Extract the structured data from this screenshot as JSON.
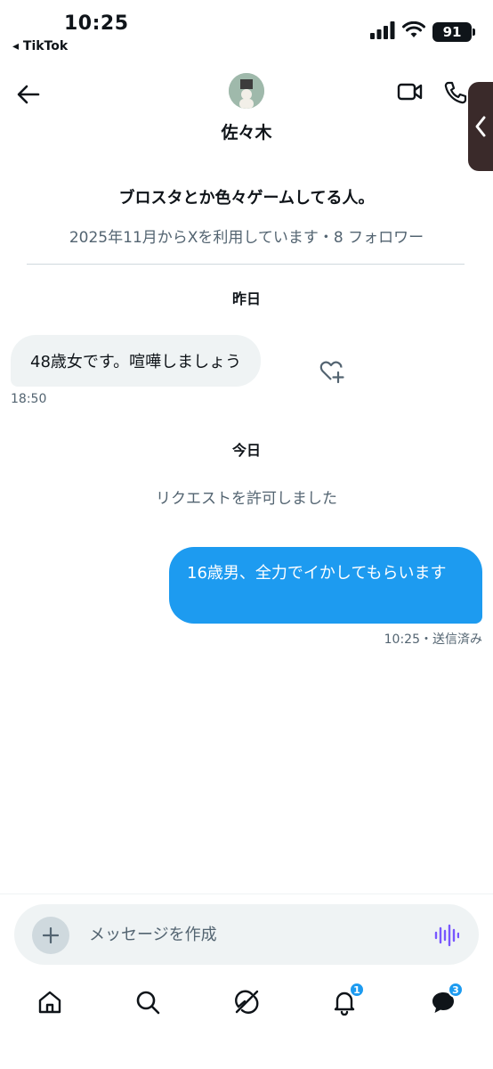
{
  "status_bar": {
    "time": "10:25",
    "back_app": "◂ TikTok",
    "battery": "91"
  },
  "header": {
    "contact_name": "佐々木"
  },
  "profile": {
    "bio": "ブロスタとか色々ゲームしてる人。",
    "meta": "2025年11月からXを利用しています・8 フォロワー"
  },
  "messages": {
    "day_yesterday": "昨日",
    "incoming_text": "48歳女です。喧嘩しましょう",
    "incoming_time": "18:50",
    "day_today": "今日",
    "system_text": "リクエストを許可しました",
    "outgoing_text": "16歳男、全力でイかしてもらいます",
    "outgoing_time": "10:25・送信済み"
  },
  "composer": {
    "placeholder": "メッセージを作成"
  },
  "tabbar": {
    "notifications_badge": "1",
    "messages_badge": "3"
  },
  "colors": {
    "accent": "#1d9bf0",
    "muted": "#536471",
    "bubble_in": "#eff3f4",
    "voice": "#7856ff"
  }
}
